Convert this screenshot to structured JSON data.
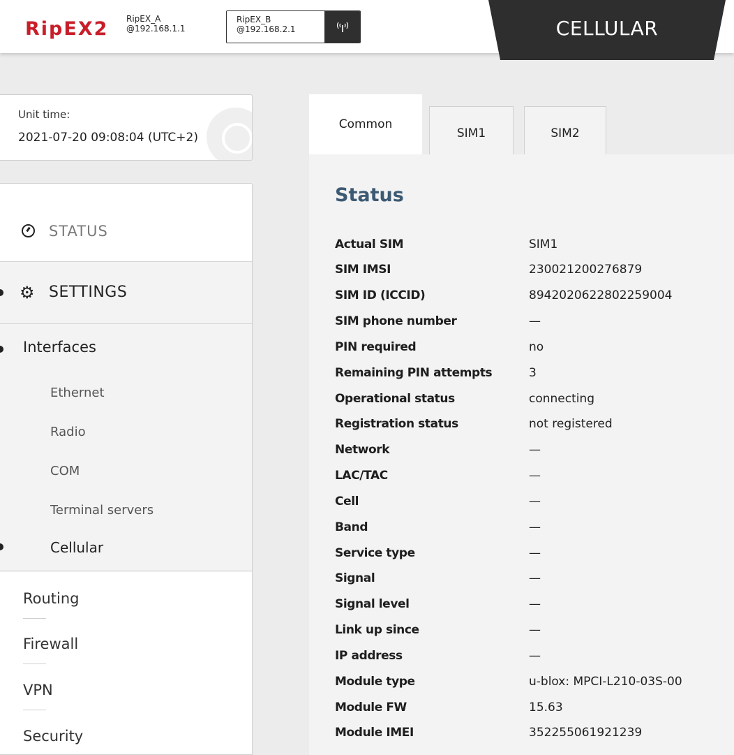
{
  "header": {
    "logo_text": "RipEX",
    "logo_suffix": "2",
    "unit_a": {
      "name": "RipEX_A",
      "ip": "@192.168.1.1"
    },
    "unit_b": {
      "name": "RipEX_B",
      "ip": "@192.168.2.1"
    },
    "page_title": "CELLULAR"
  },
  "unit_time": {
    "label": "Unit time:",
    "value": "2021-07-20 09:08:04 (UTC+2)"
  },
  "nav": {
    "status_label": "STATUS",
    "settings_label": "SETTINGS",
    "interfaces_label": "Interfaces",
    "interfaces": [
      "Ethernet",
      "Radio",
      "COM",
      "Terminal servers",
      "Cellular"
    ],
    "active_interface": "Cellular",
    "other": [
      "Routing",
      "Firewall",
      "VPN",
      "Security"
    ]
  },
  "tabs": [
    "Common",
    "SIM1",
    "SIM2"
  ],
  "active_tab": "Common",
  "status": {
    "title": "Status",
    "rows": [
      {
        "key": "Actual SIM",
        "value": "SIM1"
      },
      {
        "key": "SIM IMSI",
        "value": "230021200276879"
      },
      {
        "key": "SIM ID (ICCID)",
        "value": "8942020622802259004"
      },
      {
        "key": "SIM phone number",
        "value": "—"
      },
      {
        "key": "PIN required",
        "value": "no"
      },
      {
        "key": "Remaining PIN attempts",
        "value": "3"
      },
      {
        "key": "Operational status",
        "value": "connecting"
      },
      {
        "key": "Registration status",
        "value": "not registered"
      },
      {
        "key": "Network",
        "value": "—"
      },
      {
        "key": "LAC/TAC",
        "value": "—"
      },
      {
        "key": "Cell",
        "value": "—"
      },
      {
        "key": "Band",
        "value": "—"
      },
      {
        "key": "Service type",
        "value": "—"
      },
      {
        "key": "Signal",
        "value": "—"
      },
      {
        "key": "Signal level",
        "value": "—"
      },
      {
        "key": "Link up since",
        "value": "—"
      },
      {
        "key": "IP address",
        "value": "—"
      },
      {
        "key": "Module type",
        "value": "u-blox: MPCI-L210-03S-00"
      },
      {
        "key": "Module FW",
        "value": "15.63"
      },
      {
        "key": "Module IMEI",
        "value": "352255061921239"
      }
    ]
  },
  "colors": {
    "brand": "#c81e2a",
    "title_accent": "#3d5a73",
    "dark_tab": "#2e2e2e"
  }
}
